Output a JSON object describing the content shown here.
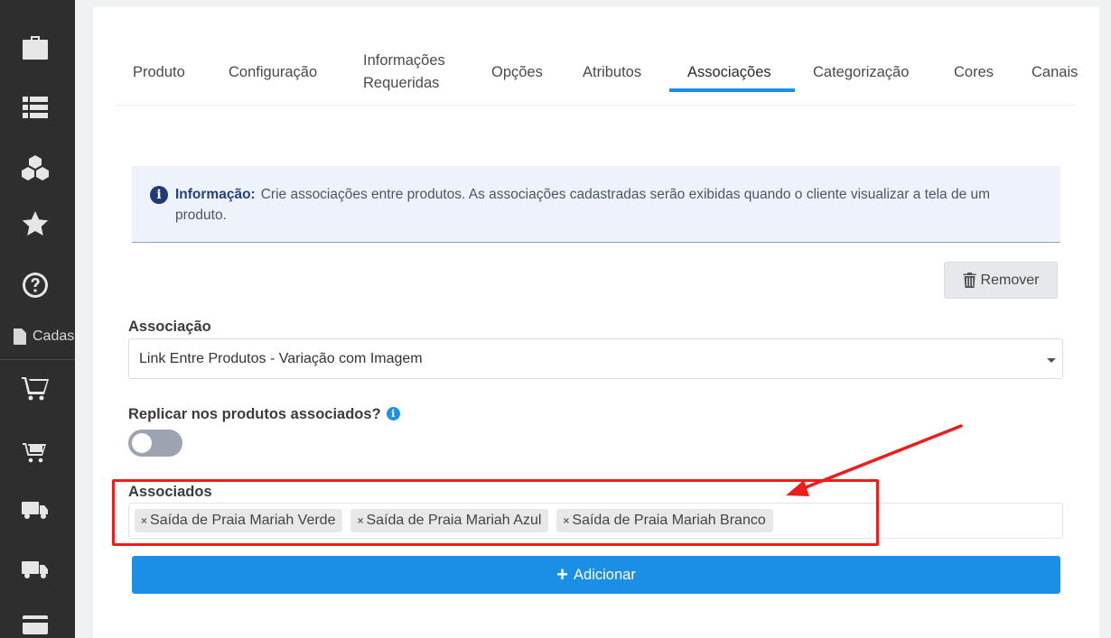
{
  "sidebar": {
    "items": [
      {
        "icon": "briefcase-icon"
      },
      {
        "icon": "list-icon"
      },
      {
        "icon": "cubes-icon"
      },
      {
        "icon": "star-icon"
      },
      {
        "icon": "question-circle-icon"
      },
      {
        "icon": "shopping-cart-icon"
      },
      {
        "icon": "cart-icon"
      },
      {
        "icon": "truck-icon"
      },
      {
        "icon": "delivery-truck-icon"
      },
      {
        "icon": "credit-card-icon"
      }
    ],
    "cadastros_label": "Cadas"
  },
  "tabs": [
    {
      "label": "Produto"
    },
    {
      "label": "Configuração"
    },
    {
      "label": "Informações Requeridas"
    },
    {
      "label": "Opções"
    },
    {
      "label": "Atributos"
    },
    {
      "label": "Associações",
      "active": true
    },
    {
      "label": "Categorização"
    },
    {
      "label": "Cores"
    },
    {
      "label": "Canais"
    }
  ],
  "info": {
    "title": "Informação:",
    "text": "Crie associações entre produtos. As associações cadastradas serão exibidas quando o cliente visualizar a tela de um produto."
  },
  "remove_button": {
    "label": "Remover"
  },
  "association": {
    "label": "Associação",
    "selected": "Link Entre Produtos - Variação com Imagem"
  },
  "replicate": {
    "label": "Replicar nos produtos associados?",
    "enabled": false
  },
  "associated": {
    "label": "Associados",
    "tags": [
      "Saída de Praia Mariah Verde",
      "Saída de Praia Mariah Azul",
      "Saída de Praia Mariah Branco"
    ]
  },
  "add_button": {
    "label": "Adicionar"
  },
  "colors": {
    "primary": "#1b8fe6",
    "sidebar": "#2e2e2e",
    "highlight": "#ef1c1c",
    "info_bg": "#eef3fb"
  }
}
